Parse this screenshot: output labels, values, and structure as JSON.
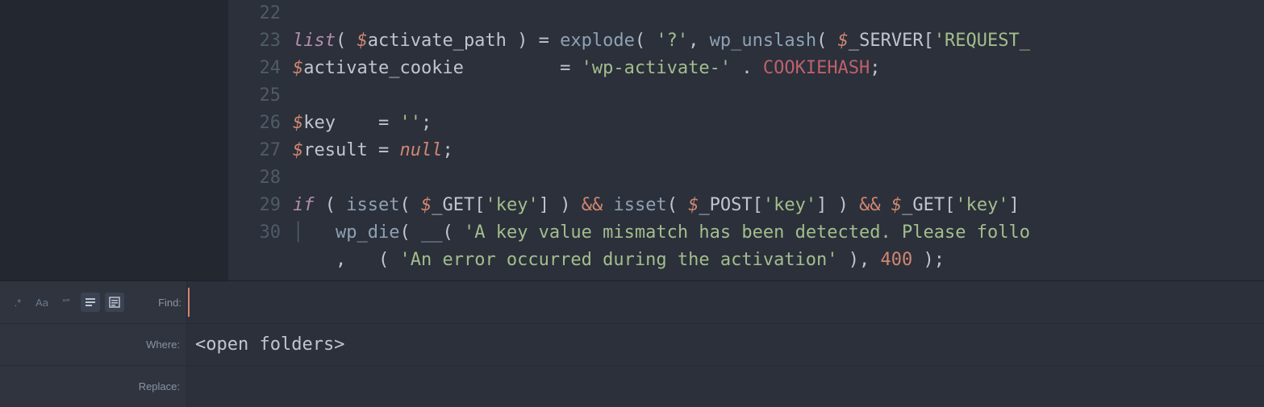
{
  "editor": {
    "first_line_number": 22,
    "lines": [
      {
        "n": 22,
        "tokens": []
      },
      {
        "n": 23,
        "tokens": [
          {
            "t": "list",
            "c": "k-key"
          },
          {
            "t": "( ",
            "c": "k-punc"
          },
          {
            "t": "$",
            "c": "k-dollar"
          },
          {
            "t": "activate_path",
            "c": "k-varn"
          },
          {
            "t": " ) ",
            "c": "k-punc"
          },
          {
            "t": "=",
            "c": "k-op"
          },
          {
            "t": " ",
            "c": "k-punc"
          },
          {
            "t": "explode",
            "c": "k-func"
          },
          {
            "t": "( ",
            "c": "k-punc"
          },
          {
            "t": "'?'",
            "c": "k-str"
          },
          {
            "t": ", ",
            "c": "k-punc"
          },
          {
            "t": "wp_unslash",
            "c": "k-func"
          },
          {
            "t": "( ",
            "c": "k-punc"
          },
          {
            "t": "$",
            "c": "k-dollar"
          },
          {
            "t": "_SERVER",
            "c": "k-varn"
          },
          {
            "t": "[",
            "c": "k-punc"
          },
          {
            "t": "'REQUEST_",
            "c": "k-str"
          }
        ]
      },
      {
        "n": 24,
        "tokens": [
          {
            "t": "$",
            "c": "k-dollar"
          },
          {
            "t": "activate_cookie",
            "c": "k-varn"
          },
          {
            "t": "         ",
            "c": "k-punc"
          },
          {
            "t": "=",
            "c": "k-op"
          },
          {
            "t": " ",
            "c": "k-punc"
          },
          {
            "t": "'wp-activate-'",
            "c": "k-str"
          },
          {
            "t": " ",
            "c": "k-punc"
          },
          {
            "t": ".",
            "c": "k-op"
          },
          {
            "t": " ",
            "c": "k-punc"
          },
          {
            "t": "COOKIEHASH",
            "c": "k-const"
          },
          {
            "t": ";",
            "c": "k-punc"
          }
        ]
      },
      {
        "n": 25,
        "tokens": []
      },
      {
        "n": 26,
        "tokens": [
          {
            "t": "$",
            "c": "k-dollar"
          },
          {
            "t": "key",
            "c": "k-varn"
          },
          {
            "t": "    ",
            "c": "k-punc"
          },
          {
            "t": "=",
            "c": "k-op"
          },
          {
            "t": " ",
            "c": "k-punc"
          },
          {
            "t": "''",
            "c": "k-str"
          },
          {
            "t": ";",
            "c": "k-punc"
          }
        ]
      },
      {
        "n": 27,
        "tokens": [
          {
            "t": "$",
            "c": "k-dollar"
          },
          {
            "t": "result",
            "c": "k-varn"
          },
          {
            "t": " ",
            "c": "k-punc"
          },
          {
            "t": "=",
            "c": "k-op"
          },
          {
            "t": " ",
            "c": "k-punc"
          },
          {
            "t": "null",
            "c": "k-null"
          },
          {
            "t": ";",
            "c": "k-punc"
          }
        ]
      },
      {
        "n": 28,
        "tokens": []
      },
      {
        "n": 29,
        "tokens": [
          {
            "t": "if",
            "c": "k-key"
          },
          {
            "t": " ( ",
            "c": "k-punc"
          },
          {
            "t": "isset",
            "c": "k-func"
          },
          {
            "t": "( ",
            "c": "k-punc"
          },
          {
            "t": "$",
            "c": "k-dollar"
          },
          {
            "t": "_GET",
            "c": "k-varn"
          },
          {
            "t": "[",
            "c": "k-punc"
          },
          {
            "t": "'key'",
            "c": "k-str"
          },
          {
            "t": "]",
            "c": "k-punc"
          },
          {
            "t": " ) ",
            "c": "k-punc"
          },
          {
            "t": "&&",
            "c": "k-and"
          },
          {
            "t": " ",
            "c": "k-punc"
          },
          {
            "t": "isset",
            "c": "k-func"
          },
          {
            "t": "( ",
            "c": "k-punc"
          },
          {
            "t": "$",
            "c": "k-dollar"
          },
          {
            "t": "_POST",
            "c": "k-varn"
          },
          {
            "t": "[",
            "c": "k-punc"
          },
          {
            "t": "'key'",
            "c": "k-str"
          },
          {
            "t": "]",
            "c": "k-punc"
          },
          {
            "t": " ) ",
            "c": "k-punc"
          },
          {
            "t": "&&",
            "c": "k-and"
          },
          {
            "t": " ",
            "c": "k-punc"
          },
          {
            "t": "$",
            "c": "k-dollar"
          },
          {
            "t": "_GET",
            "c": "k-varn"
          },
          {
            "t": "[",
            "c": "k-punc"
          },
          {
            "t": "'key'",
            "c": "k-str"
          },
          {
            "t": "]",
            "c": "k-punc"
          }
        ]
      },
      {
        "n": 30,
        "tokens": [
          {
            "t": "│   ",
            "c": "indent-guide"
          },
          {
            "t": "wp_die",
            "c": "k-func"
          },
          {
            "t": "( ",
            "c": "k-punc"
          },
          {
            "t": "__",
            "c": "k-func"
          },
          {
            "t": "( ",
            "c": "k-punc"
          },
          {
            "t": "'A key value mismatch has been detected. Please follo",
            "c": "k-str"
          }
        ]
      },
      {
        "n": null,
        "tokens": [
          {
            "t": "    ",
            "c": "k-punc"
          },
          {
            "t": ",",
            "c": "k-punc"
          },
          {
            "t": "   ",
            "c": "k-punc"
          },
          {
            "t": "( ",
            "c": "k-punc"
          },
          {
            "t": "'An error occurred during the activation'",
            "c": "k-str"
          },
          {
            "t": " ), ",
            "c": "k-punc"
          },
          {
            "t": "400",
            "c": "k-num"
          },
          {
            "t": " );",
            "c": "k-punc"
          }
        ]
      }
    ]
  },
  "search": {
    "find_label": "Find:",
    "where_label": "Where:",
    "replace_label": "Replace:",
    "find_value": "",
    "where_value": "<open folders>",
    "replace_value": "",
    "toolbar": {
      "regex": ".*",
      "case": "Aa",
      "word": "“”"
    }
  }
}
